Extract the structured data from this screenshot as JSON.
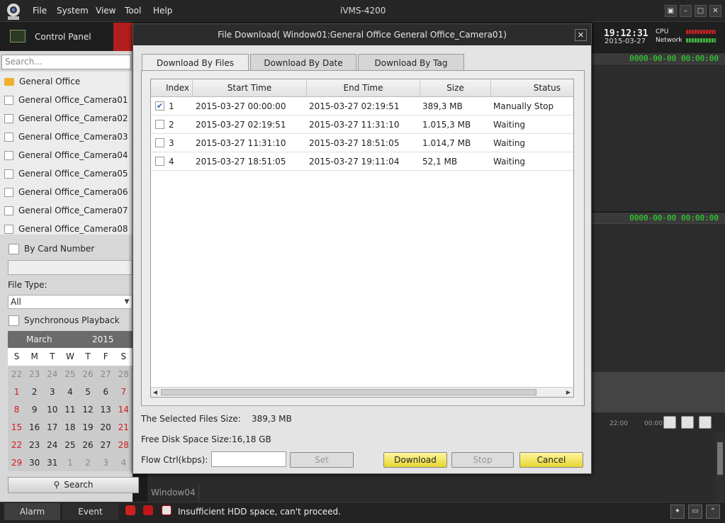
{
  "app": {
    "title": "iVMS-4200",
    "menu": [
      "File",
      "System",
      "View",
      "Tool",
      "Help"
    ]
  },
  "control_panel": {
    "label": "Control Panel"
  },
  "left": {
    "search_placeholder": "Search...",
    "tree": [
      "General Office",
      "General Office_Camera01",
      "General Office_Camera02",
      "General Office_Camera03",
      "General Office_Camera04",
      "General Office_Camera05",
      "General Office_Camera06",
      "General Office_Camera07",
      "General Office_Camera08"
    ],
    "by_card_number": "By Card Number",
    "file_type_label": "File Type:",
    "file_type_value": "All",
    "sync_playback": "Synchronous Playback",
    "calendar": {
      "month": "March",
      "year": "2015",
      "weekdays": [
        "S",
        "M",
        "T",
        "W",
        "T",
        "F",
        "S"
      ],
      "rows": [
        [
          "22",
          "23",
          "24",
          "25",
          "26",
          "27",
          "28"
        ],
        [
          "1",
          "2",
          "3",
          "4",
          "5",
          "6",
          "7"
        ],
        [
          "8",
          "9",
          "10",
          "11",
          "12",
          "13",
          "14"
        ],
        [
          "15",
          "16",
          "17",
          "18",
          "19",
          "20",
          "21"
        ],
        [
          "22",
          "23",
          "24",
          "25",
          "26",
          "27",
          "28"
        ],
        [
          "29",
          "30",
          "31",
          "1",
          "2",
          "3",
          "4"
        ]
      ]
    },
    "search_button": "Search"
  },
  "right": {
    "clock_time": "19:12:31",
    "clock_date": "2015-03-27",
    "cpu_label": "CPU",
    "network_label": "Network",
    "video_timestamp_1": "0000-00-00 00:00:00",
    "video_timestamp_2": "0000-00-00 00:00:00",
    "timeline_label_1": "22:00",
    "timeline_label_2": "00:00",
    "window_label": "Window04"
  },
  "dialog": {
    "title": "File Download( Window01:General Office General Office_Camera01)",
    "tabs": [
      "Download By Files",
      "Download By Date",
      "Download By Tag"
    ],
    "columns": [
      "Index",
      "Start Time",
      "End Time",
      "Size",
      "Status"
    ],
    "rows": [
      {
        "index": "1",
        "start": "2015-03-27 00:00:00",
        "end": "2015-03-27 02:19:51",
        "size": "389,3 MB",
        "status": "Manually Stop",
        "checked": "✔"
      },
      {
        "index": "2",
        "start": "2015-03-27 02:19:51",
        "end": "2015-03-27 11:31:10",
        "size": "1.015,3 MB",
        "status": "Waiting",
        "checked": ""
      },
      {
        "index": "3",
        "start": "2015-03-27 11:31:10",
        "end": "2015-03-27 18:51:05",
        "size": "1.014,7 MB",
        "status": "Waiting",
        "checked": ""
      },
      {
        "index": "4",
        "start": "2015-03-27 18:51:05",
        "end": "2015-03-27 19:11:04",
        "size": "52,1 MB",
        "status": "Waiting",
        "checked": ""
      }
    ],
    "selected_size_label": "The Selected Files Size:",
    "selected_size_value": "389,3 MB",
    "free_disk_label": "Free Disk Space Size:",
    "free_disk_value": "16,18 GB",
    "flow_ctrl_label": "Flow Ctrl(kbps):",
    "buttons": {
      "set": "Set",
      "download": "Download",
      "stop": "Stop",
      "cancel": "Cancel"
    }
  },
  "status": {
    "alarm_tab": "Alarm",
    "event_tab": "Event",
    "message": "Insufficient HDD space, can't proceed."
  },
  "colors": {
    "accent_red": "#b21e1e",
    "osd_green": "#2ee62e",
    "button_yellow": "#e6d530"
  }
}
